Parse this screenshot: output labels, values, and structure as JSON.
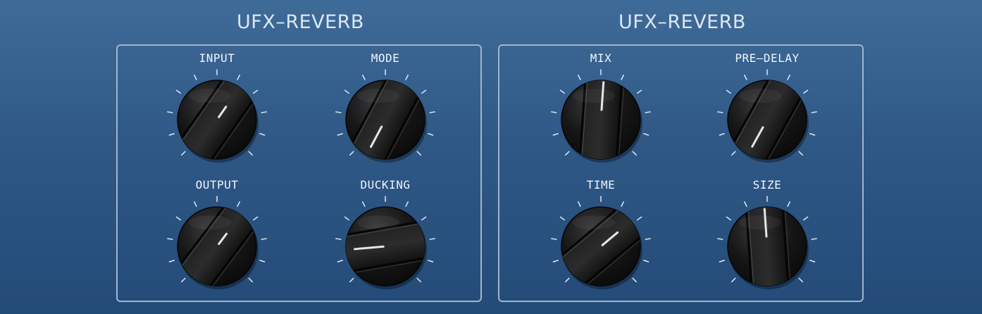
{
  "colors": {
    "label": "#f1f5fa",
    "tick": "#d7e2ee",
    "pointer": "#e6e6e6",
    "panelBorder": "#9fb6d0"
  },
  "panels": [
    {
      "title": "UFX–REVERB",
      "knobs": [
        {
          "label": "INPUT",
          "value": 0.69,
          "pointer_deg": 35,
          "groove_deg": 35,
          "pointer_len": 0.4,
          "pointer_inner": 0.08
        },
        {
          "label": "MODE",
          "value": 0.15,
          "pointer_deg": 208,
          "groove_deg": 28,
          "pointer_len": 0.78,
          "pointer_inner": 0.2
        },
        {
          "label": "OUTPUT",
          "value": 0.69,
          "pointer_deg": 37,
          "groove_deg": 37,
          "pointer_len": 0.4,
          "pointer_inner": 0.08
        },
        {
          "label": "DUCKING",
          "value": 0.22,
          "pointer_deg": 265,
          "groove_deg": 80,
          "pointer_len": 0.78,
          "pointer_inner": 0.05
        }
      ]
    },
    {
      "title": "UFX–REVERB",
      "knobs": [
        {
          "label": "MIX",
          "value": 0.51,
          "pointer_deg": 4,
          "groove_deg": 4,
          "pointer_len": 0.95,
          "pointer_inner": 0.25
        },
        {
          "label": "PRE–DELAY",
          "value": 0.15,
          "pointer_deg": 209,
          "groove_deg": 29,
          "pointer_len": 0.78,
          "pointer_inner": 0.22
        },
        {
          "label": "TIME",
          "value": 0.7,
          "pointer_deg": 50,
          "groove_deg": 50,
          "pointer_len": 0.55,
          "pointer_inner": 0.05
        },
        {
          "label": "SIZE",
          "value": 0.49,
          "pointer_deg": -4,
          "groove_deg": -4,
          "pointer_len": 0.95,
          "pointer_inner": 0.25
        }
      ]
    }
  ]
}
